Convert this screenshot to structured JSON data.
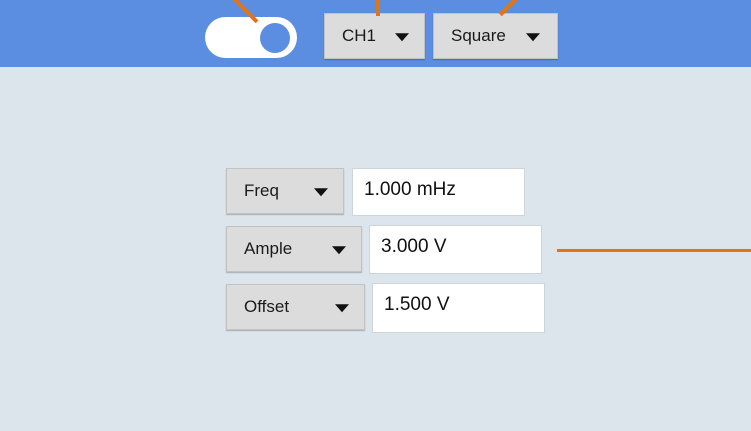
{
  "toolbar": {
    "output_toggle": {
      "on": true
    },
    "channel_select": {
      "value": "CH1"
    },
    "waveform_select": {
      "value": "Square"
    }
  },
  "params": [
    {
      "selector": "Freq",
      "value": "1.000 mHz"
    },
    {
      "selector": "Ample",
      "value": "3.000 V"
    },
    {
      "selector": "Offset",
      "value": "1.500 V"
    }
  ],
  "colors": {
    "topbar": "#5b8ee0",
    "background": "#dce5ec",
    "annotation": "#e27418"
  }
}
